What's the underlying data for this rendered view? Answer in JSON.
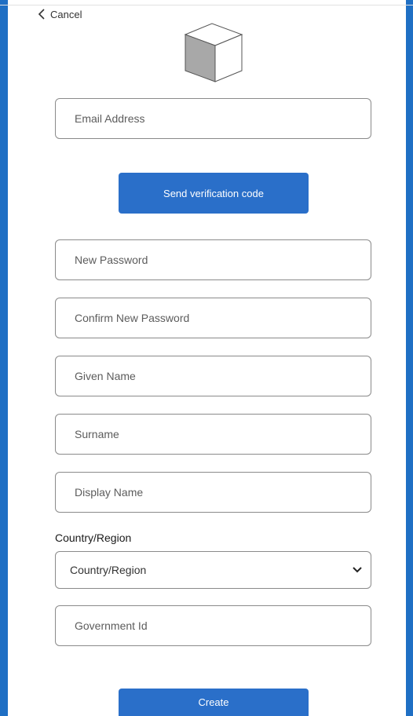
{
  "header": {
    "cancel_label": "Cancel",
    "logo_icon": "cube-logo-icon"
  },
  "form": {
    "email": {
      "placeholder": "Email Address",
      "value": ""
    },
    "send_code_label": "Send verification code",
    "new_password": {
      "placeholder": "New Password",
      "value": ""
    },
    "confirm_password": {
      "placeholder": "Confirm New Password",
      "value": ""
    },
    "given_name": {
      "placeholder": "Given Name",
      "value": ""
    },
    "surname": {
      "placeholder": "Surname",
      "value": ""
    },
    "display_name": {
      "placeholder": "Display Name",
      "value": ""
    },
    "country": {
      "label": "Country/Region",
      "selected": "Country/Region"
    },
    "government_id": {
      "placeholder": "Government Id",
      "value": ""
    },
    "create_label": "Create"
  },
  "colors": {
    "accent": "#2a6fc9",
    "frame": "#1f6fc4",
    "border": "#8a8a8a"
  }
}
